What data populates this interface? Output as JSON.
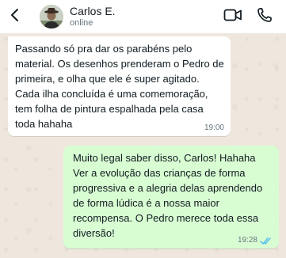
{
  "header": {
    "contact_name": "Carlos E.",
    "status": "online",
    "back_icon": "arrow-left-icon",
    "video_icon": "video-call-icon",
    "phone_icon": "phone-call-icon"
  },
  "messages": [
    {
      "direction": "incoming",
      "text": "Passando só pra dar os parabéns pelo material. Os desenhos prenderam o Pedro de primeira, e olha que ele é super agitado. Cada ilha concluída é uma comemoração, tem folha de pintura espalhada pela casa toda hahaha",
      "time": "19:00"
    },
    {
      "direction": "outgoing",
      "text": "Muito legal saber disso, Carlos! Hahaha Ver a evolução das crianças de forma progressiva e a alegria delas aprendendo de forma lúdica é a nossa maior recompensa. O Pedro merece toda essa diversão!",
      "time": "19:28",
      "status": "read"
    }
  ],
  "colors": {
    "incoming_bubble": "#ffffff",
    "outgoing_bubble": "#d9fdd3",
    "read_ticks": "#53bdeb",
    "wallpaper": "#efe7de"
  }
}
